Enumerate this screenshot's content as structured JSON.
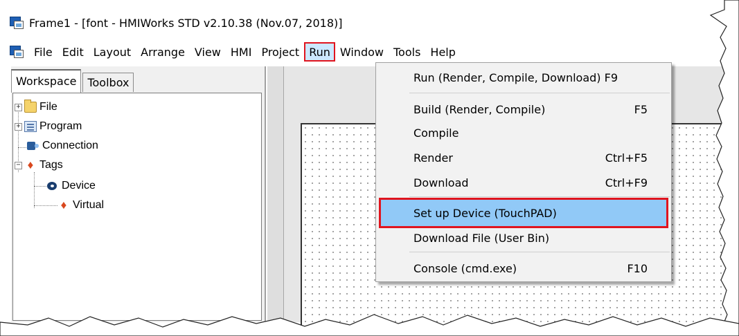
{
  "title_bar": {
    "title": "Frame1 - [font - HMIWorks STD v2.10.38 (Nov.07, 2018)]"
  },
  "menu": {
    "items": [
      "File",
      "Edit",
      "Layout",
      "Arrange",
      "View",
      "HMI",
      "Project",
      "Run",
      "Window",
      "Tools",
      "Help"
    ],
    "active": "Run",
    "highlight_color": "#e0141e"
  },
  "left_pane": {
    "tabs": [
      "Workspace",
      "Toolbox"
    ],
    "active_tab": "Workspace",
    "tree": [
      {
        "label": "File",
        "icon": "folder-icon",
        "expander": "+"
      },
      {
        "label": "Program",
        "icon": "program-icon",
        "expander": "+"
      },
      {
        "label": "Connection",
        "icon": "connection-icon",
        "expander": ""
      },
      {
        "label": "Tags",
        "icon": "tags-icon",
        "expander": "−"
      },
      {
        "label": "Device",
        "icon": "device-icon",
        "expander": ""
      },
      {
        "label": "Virtual",
        "icon": "virtual-icon",
        "expander": ""
      }
    ]
  },
  "run_menu": {
    "items": [
      {
        "label": "Run (Render, Compile, Download) F9",
        "shortcut": ""
      },
      {
        "label": "Build (Render, Compile)",
        "shortcut": "F5"
      },
      {
        "label": "Compile",
        "shortcut": ""
      },
      {
        "label": "Render",
        "shortcut": "Ctrl+F5"
      },
      {
        "label": "Download",
        "shortcut": "Ctrl+F9"
      },
      {
        "label": "Set up Device (TouchPAD)",
        "shortcut": ""
      },
      {
        "label": "Download File (User Bin)",
        "shortcut": ""
      },
      {
        "label": "Console (cmd.exe)",
        "shortcut": "F10"
      }
    ],
    "highlighted": "Set up Device (TouchPAD)",
    "highlight_bg": "#91c9f7"
  }
}
